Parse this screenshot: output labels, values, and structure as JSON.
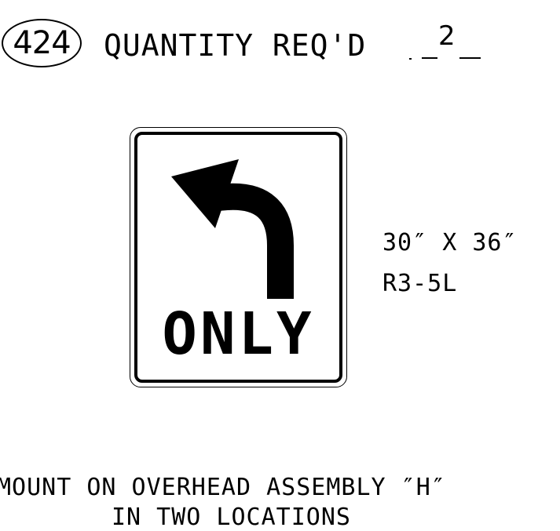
{
  "sheet_number": "424",
  "quantity": {
    "label": "QUANTITY REQ'D",
    "value": "2"
  },
  "sign": {
    "legend": "ONLY",
    "icon": "left-turn-arrow-icon",
    "size": "30″ X 36″",
    "code": "R3-5L"
  },
  "notes": {
    "line1": "MOUNT ON OVERHEAD ASSEMBLY ″H″",
    "line2": "IN TWO LOCATIONS"
  }
}
